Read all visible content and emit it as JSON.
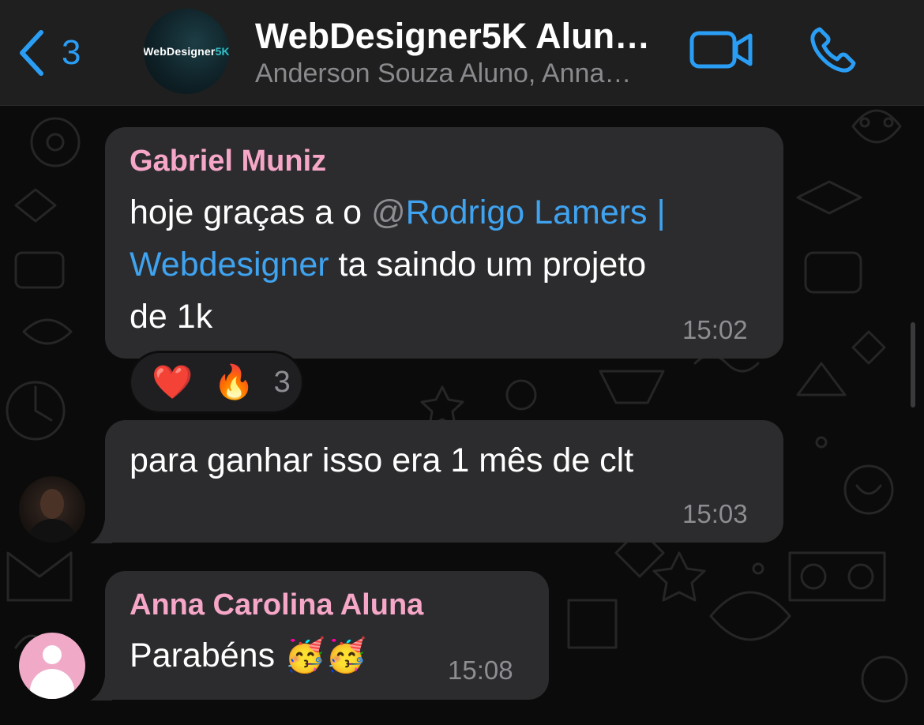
{
  "header": {
    "back_count": "3",
    "avatar_logo_main": "WebDesigner",
    "avatar_logo_accent": "5K",
    "title": "WebDesigner5K Alun…",
    "subtitle": "Anderson Souza Aluno, Anna…"
  },
  "messages": [
    {
      "sender": "Gabriel Muniz",
      "line1_before": "hoje graças a o ",
      "line1_at": "@",
      "line1_mention": "Rodrigo Lamers |",
      "line2_mention": "Webdesigner",
      "line2_after": " ta saindo um projeto",
      "line3": "de 1k",
      "time": "15:02",
      "reactions": {
        "emoji_1": "❤️",
        "emoji_2": "🔥",
        "count": "3"
      }
    },
    {
      "text": "para ganhar isso era 1 mês de clt",
      "time": "15:03"
    },
    {
      "sender": "Anna Carolina Aluna",
      "text": "Parabéns",
      "emojis": "🥳🥳",
      "time": "15:08"
    }
  ],
  "colors": {
    "accent": "#2a9ef5",
    "sender_name": "#f6a7c8",
    "bubble": "#2c2c2e",
    "background": "#0b0b0b",
    "mention": "#3fa3f0"
  },
  "icons": [
    "chevron-left-icon",
    "video-camera-icon",
    "phone-icon",
    "default-user-icon"
  ]
}
